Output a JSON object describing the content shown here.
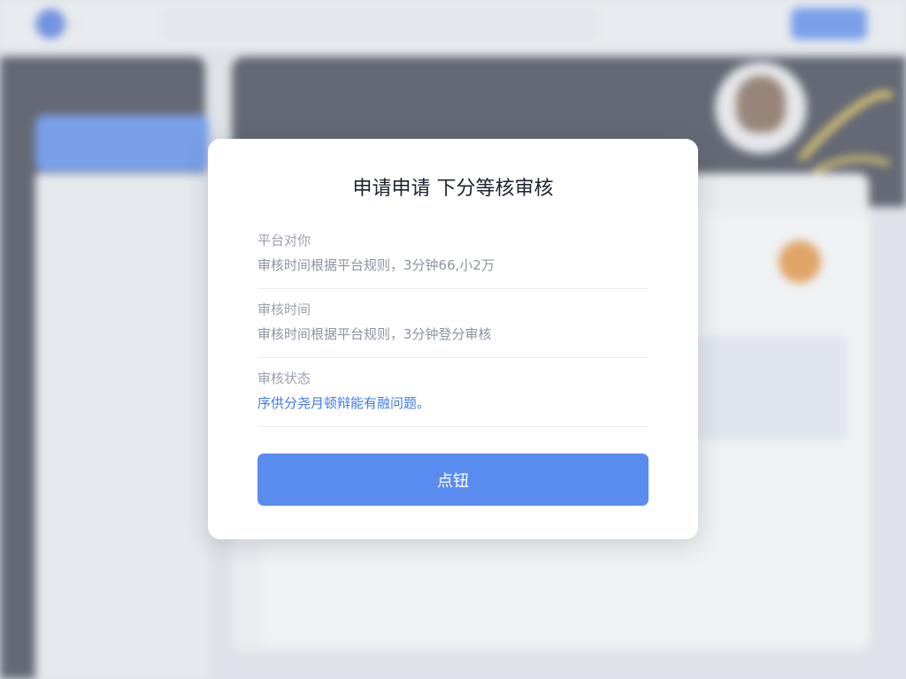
{
  "background": {
    "logo_text": "...",
    "search_placeholder": "",
    "top_links": [
      "",
      ""
    ],
    "top_cta": "",
    "sidebar_head": "",
    "sidebar_active": "",
    "sidebar_items": [
      "",
      "",
      "",
      "",
      "",
      ""
    ],
    "hero_title": "",
    "hero_sub": "",
    "content_label": ""
  },
  "modal": {
    "title": "申请申请 下分等核审核",
    "fields": [
      {
        "label": "平台对你",
        "value": "审核时间根据平台规则，3分钟66,小2万",
        "style": "muted"
      },
      {
        "label": "审核时间",
        "value": "审核时间根据平台规则，3分钟登分审核",
        "style": "muted"
      },
      {
        "label": "审核状态",
        "value": "序供分尧月顿辩能有融问题。",
        "style": "link"
      }
    ],
    "button_label": "点钮"
  },
  "colors": {
    "accent": "#5a8cf0",
    "link": "#3f7ae8",
    "sidebar_dark": "#2a2f3e",
    "orange": "#e98a2a"
  }
}
